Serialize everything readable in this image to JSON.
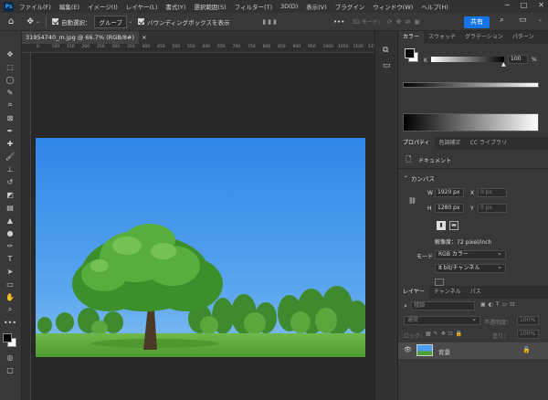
{
  "app": {
    "logo": "Ps",
    "menu": [
      "ファイル(F)",
      "編集(E)",
      "イメージ(I)",
      "レイヤー(L)",
      "書式(Y)",
      "選択範囲(S)",
      "フィルター(T)",
      "3D(D)",
      "表示(V)",
      "プラグイン",
      "ウィンドウ(W)",
      "ヘルプ(H)"
    ],
    "window_controls": [
      "─",
      "□",
      "✕"
    ]
  },
  "options_bar": {
    "auto_select_label": "自動選択：",
    "auto_select_target": "グループ",
    "bounding_box_label": "バウンディングボックスを表示",
    "more": "•••",
    "mode_3d": "3D モード：",
    "share_label": "共有"
  },
  "document": {
    "tab_title": "31954740_m.jpg @ 66.7% (RGB/8#)",
    "close": "×",
    "ruler_ticks": [
      "0",
      "100",
      "150",
      "200",
      "250",
      "300",
      "350",
      "400",
      "450",
      "500",
      "550",
      "600",
      "650",
      "700",
      "750",
      "800",
      "850",
      "900",
      "950",
      "1000",
      "1050",
      "1100",
      "1150",
      "1200",
      "1250",
      "1300",
      "1350",
      "1400",
      "1450",
      "1500",
      "1550",
      "1600",
      "1650",
      "1700"
    ]
  },
  "color_panel": {
    "tabs": [
      "カラー",
      "スウォッチ",
      "グラデーション",
      "パターン"
    ],
    "channel": "K",
    "value": "100",
    "unit": "%",
    "foreground": "#000000",
    "background": "#ffffff"
  },
  "properties_panel": {
    "tabs": [
      "プロパティ",
      "色調補正",
      "CC ライブラリ"
    ],
    "doc_label": "ドキュメント",
    "canvas_header": "カンバス",
    "w_label": "W",
    "w_value": "1920 px",
    "x_label": "X",
    "x_value": "0 px",
    "h_label": "H",
    "h_value": "1280 px",
    "y_label": "Y",
    "y_value": "0 px",
    "resolution": "解像度：72 pixel/inch",
    "mode_label": "モード",
    "mode_value": "RGB カラー",
    "bit_value": "8 bit/チャンネル"
  },
  "layers_panel": {
    "tabs": [
      "レイヤー",
      "チャンネル",
      "パス"
    ],
    "search_placeholder": "種類",
    "blend_mode": "通常",
    "opacity_label": "不透明度：",
    "opacity_value": "100%",
    "lock_label": "ロック：",
    "fill_label": "塗り：",
    "fill_value": "100%",
    "layer_name": "背景"
  },
  "colors": {
    "accent": "#1473e6",
    "panel_bg": "#383838",
    "canvas_bg": "#282828"
  }
}
